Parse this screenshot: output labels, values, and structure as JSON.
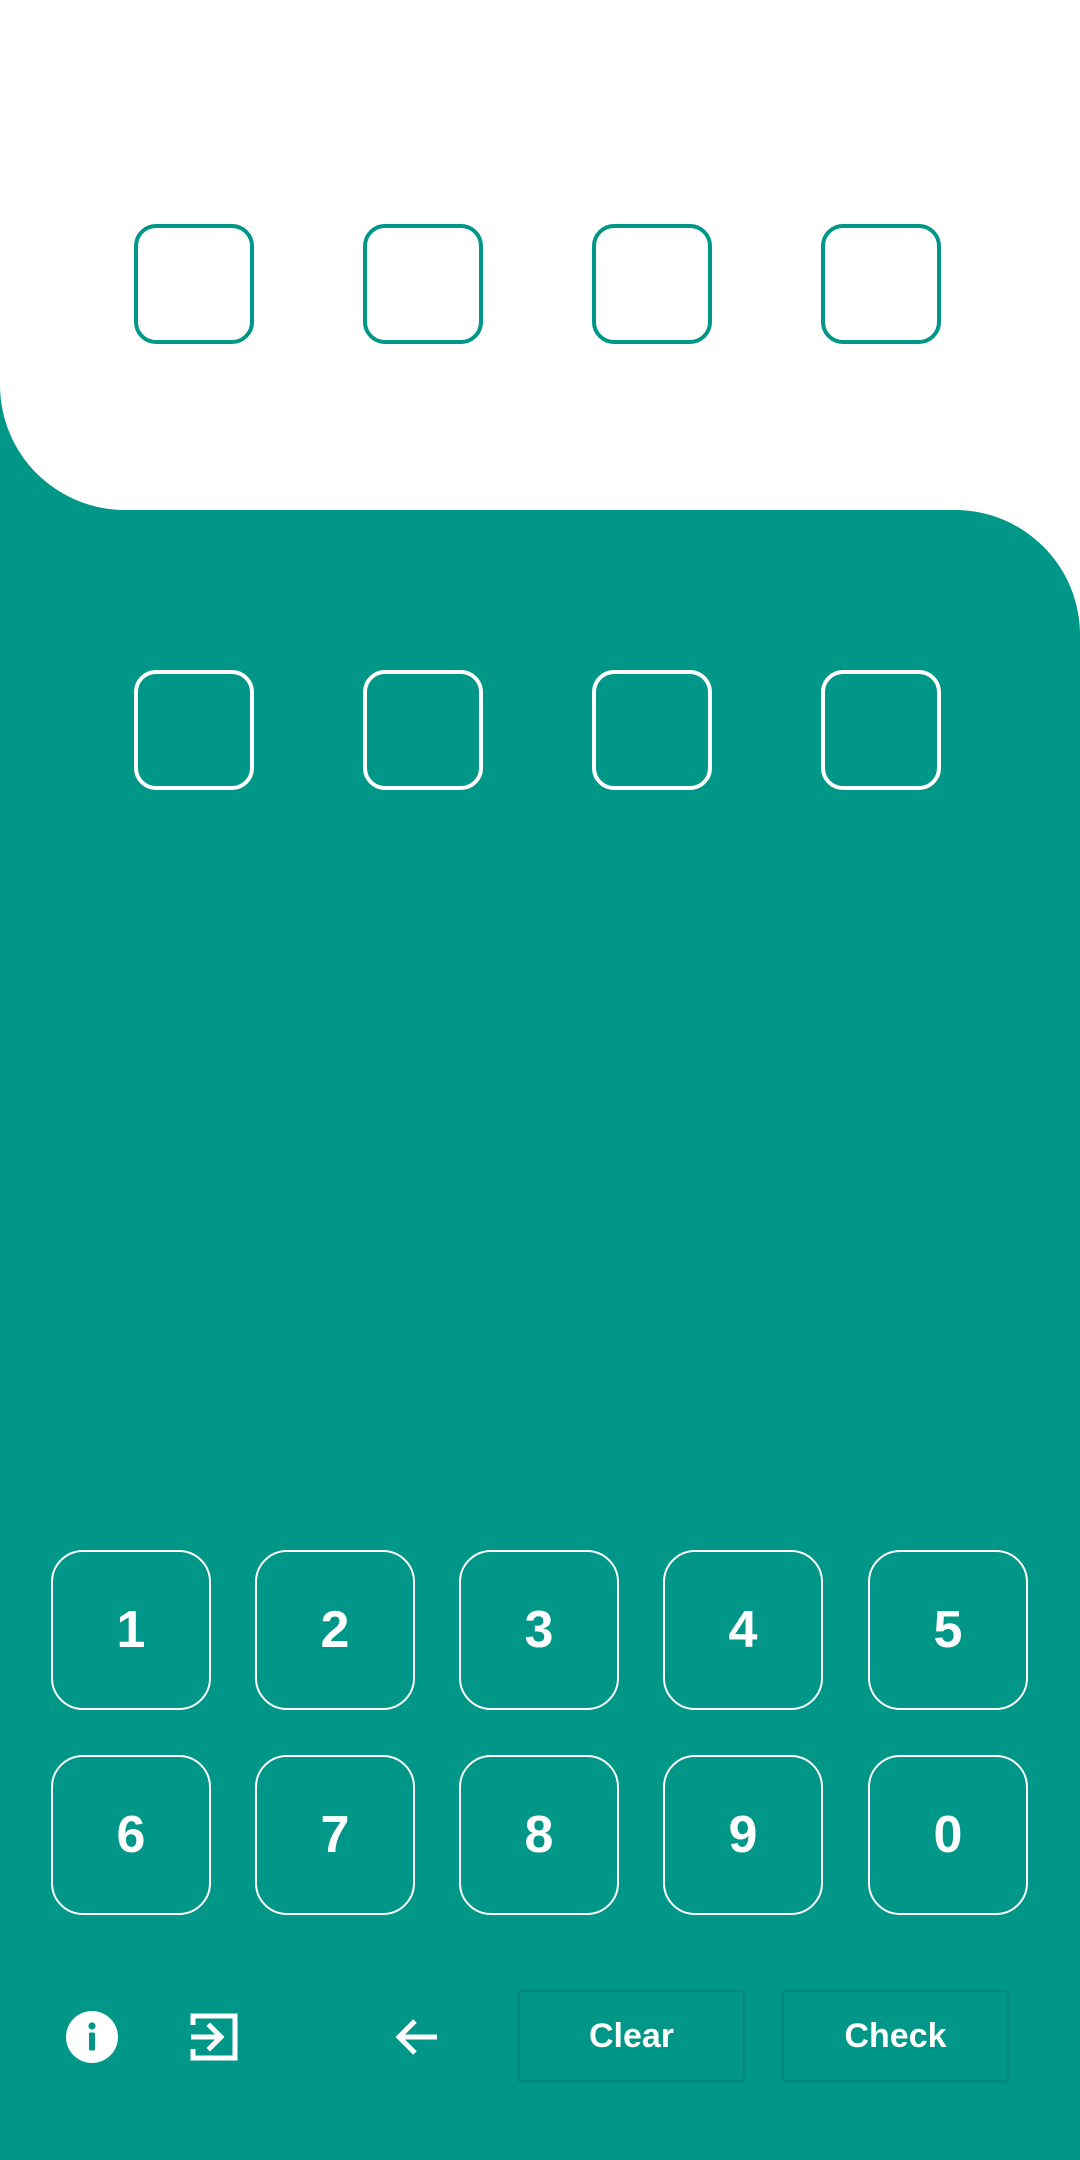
{
  "colors": {
    "primary": "#009688",
    "surface": "#ffffff",
    "on_primary": "#ffffff"
  },
  "target_slots": [
    "",
    "",
    "",
    ""
  ],
  "guess_slots": [
    "",
    "",
    "",
    ""
  ],
  "keypad": {
    "row1": [
      "1",
      "2",
      "3",
      "4",
      "5"
    ],
    "row2": [
      "6",
      "7",
      "8",
      "9",
      "0"
    ]
  },
  "toolbar": {
    "info_icon": "info-icon",
    "exit_icon": "exit-icon",
    "back_icon": "arrow-left-icon",
    "clear_label": "Clear",
    "check_label": "Check"
  }
}
